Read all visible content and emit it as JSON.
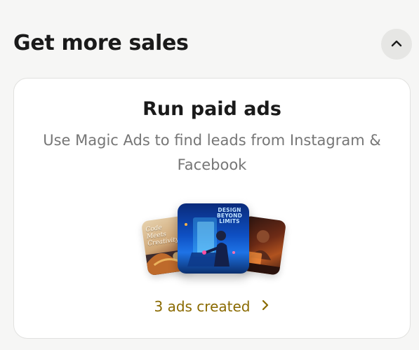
{
  "section": {
    "title": "Get more sales",
    "collapse_icon": "chevron-up-icon"
  },
  "card": {
    "title": "Run paid ads",
    "description": "Use Magic Ads to find leads from Instagram & Facebook",
    "thumbnails": {
      "left_text": "Code Meets Creativity",
      "center_text": "DESIGN BEYOND LIMITS",
      "right_icon": "person-at-computer-image"
    },
    "link_label": "3 ads created",
    "link_icon": "chevron-right-icon"
  },
  "colors": {
    "background": "#f6f6f5",
    "card_bg": "#ffffff",
    "accent_gold": "#8a6a00",
    "muted_text": "#767676"
  }
}
